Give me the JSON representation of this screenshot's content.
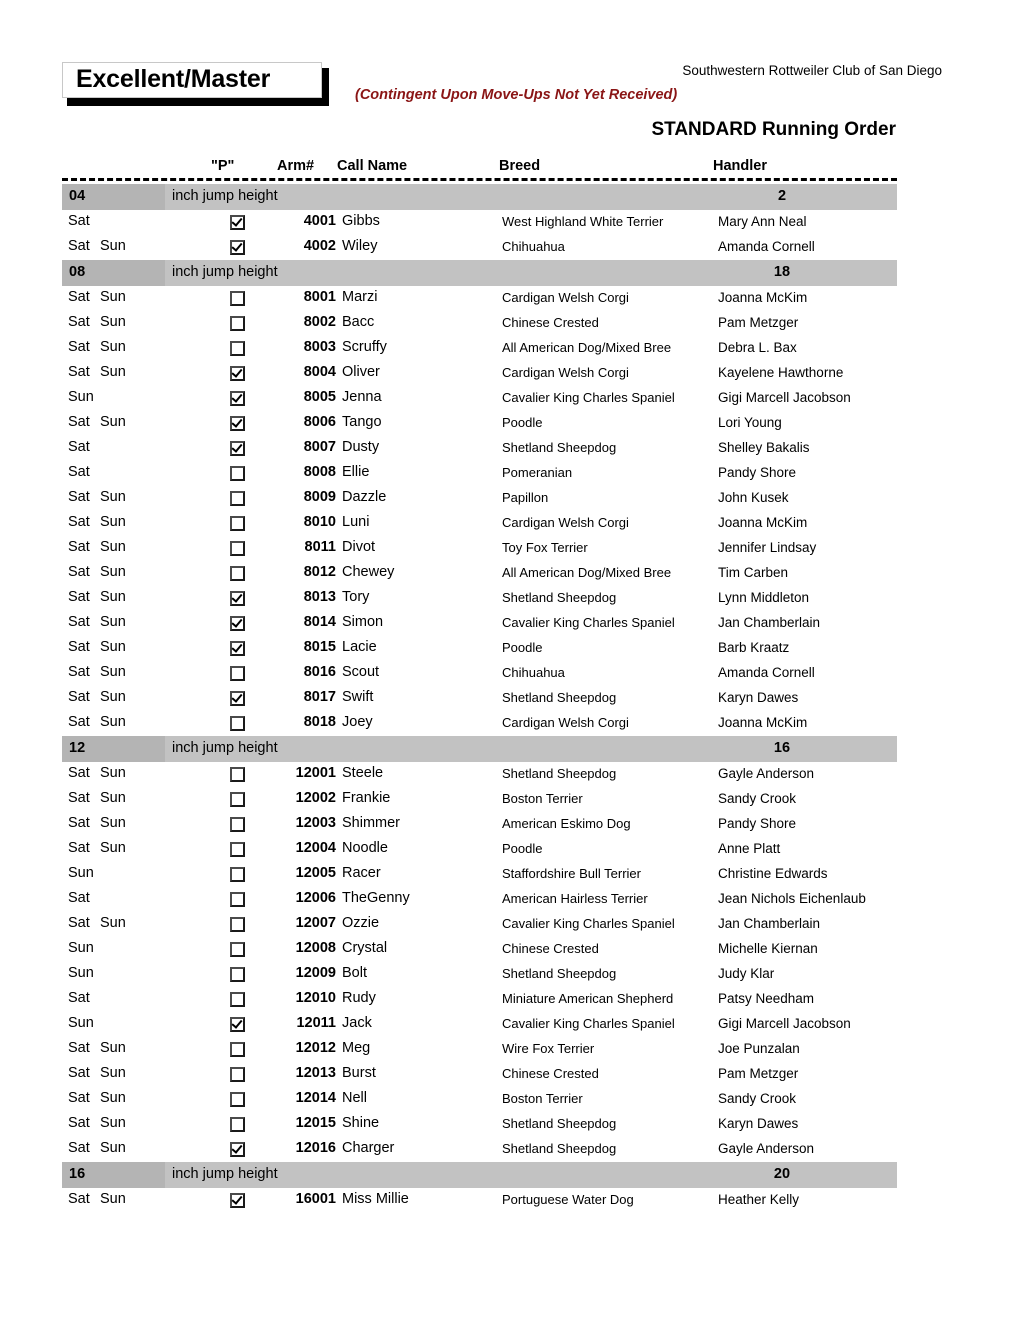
{
  "header": {
    "title": "Excellent/Master",
    "club_name": "Southwestern Rottweiler Club of San Diego",
    "contingent_note": "(Contingent Upon Move-Ups Not Yet Received)",
    "running_order": "STANDARD Running Order",
    "accent_color": "#8a1515"
  },
  "columns": {
    "days": "",
    "p": "\"P\"",
    "arm": "Arm#",
    "call_name": "Call Name",
    "breed": "Breed",
    "handler": "Handler"
  },
  "band_label": "inch jump height",
  "groups": [
    {
      "height": "04",
      "label": "inch jump height",
      "count": "2",
      "rows": [
        {
          "days_sat": "Sat",
          "days_sun": "",
          "checked": true,
          "arm": "4001",
          "call_name": "Gibbs",
          "breed": "West Highland White Terrier",
          "handler": "Mary Ann Neal"
        },
        {
          "days_sat": "Sat",
          "days_sun": "Sun",
          "checked": true,
          "arm": "4002",
          "call_name": "Wiley",
          "breed": "Chihuahua",
          "handler": "Amanda Cornell"
        }
      ]
    },
    {
      "height": "08",
      "label": "inch jump height",
      "count": "18",
      "rows": [
        {
          "days_sat": "Sat",
          "days_sun": "Sun",
          "checked": false,
          "arm": "8001",
          "call_name": "Marzi",
          "breed": "Cardigan Welsh Corgi",
          "handler": "Joanna McKim"
        },
        {
          "days_sat": "Sat",
          "days_sun": "Sun",
          "checked": false,
          "arm": "8002",
          "call_name": "Bacc",
          "breed": "Chinese Crested",
          "handler": "Pam Metzger"
        },
        {
          "days_sat": "Sat",
          "days_sun": "Sun",
          "checked": false,
          "arm": "8003",
          "call_name": "Scruffy",
          "breed": "All American Dog/Mixed Bree",
          "handler": "Debra L. Bax"
        },
        {
          "days_sat": "Sat",
          "days_sun": "Sun",
          "checked": true,
          "arm": "8004",
          "call_name": "Oliver",
          "breed": "Cardigan Welsh Corgi",
          "handler": "Kayelene Hawthorne"
        },
        {
          "days_sat": "Sun",
          "days_sun": "",
          "checked": true,
          "arm": "8005",
          "call_name": "Jenna",
          "breed": "Cavalier King Charles Spaniel",
          "handler": "Gigi Marcell Jacobson"
        },
        {
          "days_sat": "Sat",
          "days_sun": "Sun",
          "checked": true,
          "arm": "8006",
          "call_name": "Tango",
          "breed": "Poodle",
          "handler": "Lori Young"
        },
        {
          "days_sat": "Sat",
          "days_sun": "",
          "checked": true,
          "arm": "8007",
          "call_name": "Dusty",
          "breed": "Shetland Sheepdog",
          "handler": "Shelley Bakalis"
        },
        {
          "days_sat": "Sat",
          "days_sun": "",
          "checked": false,
          "arm": "8008",
          "call_name": "Ellie",
          "breed": "Pomeranian",
          "handler": "Pandy Shore"
        },
        {
          "days_sat": "Sat",
          "days_sun": "Sun",
          "checked": false,
          "arm": "8009",
          "call_name": "Dazzle",
          "breed": "Papillon",
          "handler": "John Kusek"
        },
        {
          "days_sat": "Sat",
          "days_sun": "Sun",
          "checked": false,
          "arm": "8010",
          "call_name": "Luni",
          "breed": "Cardigan Welsh Corgi",
          "handler": "Joanna McKim"
        },
        {
          "days_sat": "Sat",
          "days_sun": "Sun",
          "checked": false,
          "arm": "8011",
          "call_name": "Divot",
          "breed": "Toy Fox Terrier",
          "handler": "Jennifer Lindsay"
        },
        {
          "days_sat": "Sat",
          "days_sun": "Sun",
          "checked": false,
          "arm": "8012",
          "call_name": "Chewey",
          "breed": "All American Dog/Mixed Bree",
          "handler": "Tim Carben"
        },
        {
          "days_sat": "Sat",
          "days_sun": "Sun",
          "checked": true,
          "arm": "8013",
          "call_name": "Tory",
          "breed": "Shetland Sheepdog",
          "handler": "Lynn Middleton"
        },
        {
          "days_sat": "Sat",
          "days_sun": "Sun",
          "checked": true,
          "arm": "8014",
          "call_name": "Simon",
          "breed": "Cavalier King Charles Spaniel",
          "handler": "Jan Chamberlain"
        },
        {
          "days_sat": "Sat",
          "days_sun": "Sun",
          "checked": true,
          "arm": "8015",
          "call_name": "Lacie",
          "breed": "Poodle",
          "handler": "Barb Kraatz"
        },
        {
          "days_sat": "Sat",
          "days_sun": "Sun",
          "checked": false,
          "arm": "8016",
          "call_name": "Scout",
          "breed": "Chihuahua",
          "handler": "Amanda Cornell"
        },
        {
          "days_sat": "Sat",
          "days_sun": "Sun",
          "checked": true,
          "arm": "8017",
          "call_name": "Swift",
          "breed": "Shetland Sheepdog",
          "handler": "Karyn Dawes"
        },
        {
          "days_sat": "Sat",
          "days_sun": "Sun",
          "checked": false,
          "arm": "8018",
          "call_name": "Joey",
          "breed": "Cardigan Welsh Corgi",
          "handler": "Joanna McKim"
        }
      ]
    },
    {
      "height": "12",
      "label": "inch jump height",
      "count": "16",
      "rows": [
        {
          "days_sat": "Sat",
          "days_sun": "Sun",
          "checked": false,
          "arm": "12001",
          "call_name": "Steele",
          "breed": "Shetland Sheepdog",
          "handler": "Gayle Anderson"
        },
        {
          "days_sat": "Sat",
          "days_sun": "Sun",
          "checked": false,
          "arm": "12002",
          "call_name": "Frankie",
          "breed": "Boston Terrier",
          "handler": "Sandy Crook"
        },
        {
          "days_sat": "Sat",
          "days_sun": "Sun",
          "checked": false,
          "arm": "12003",
          "call_name": "Shimmer",
          "breed": "American Eskimo Dog",
          "handler": "Pandy Shore"
        },
        {
          "days_sat": "Sat",
          "days_sun": "Sun",
          "checked": false,
          "arm": "12004",
          "call_name": "Noodle",
          "breed": "Poodle",
          "handler": "Anne Platt"
        },
        {
          "days_sat": "Sun",
          "days_sun": "",
          "checked": false,
          "arm": "12005",
          "call_name": "Racer",
          "breed": "Staffordshire Bull Terrier",
          "handler": "Christine Edwards"
        },
        {
          "days_sat": "Sat",
          "days_sun": "",
          "checked": false,
          "arm": "12006",
          "call_name": "TheGenny",
          "breed": "American Hairless Terrier",
          "handler": "Jean Nichols Eichenlaub"
        },
        {
          "days_sat": "Sat",
          "days_sun": "Sun",
          "checked": false,
          "arm": "12007",
          "call_name": "Ozzie",
          "breed": "Cavalier King Charles Spaniel",
          "handler": "Jan Chamberlain"
        },
        {
          "days_sat": "Sun",
          "days_sun": "",
          "checked": false,
          "arm": "12008",
          "call_name": "Crystal",
          "breed": "Chinese Crested",
          "handler": "Michelle Kiernan"
        },
        {
          "days_sat": "Sun",
          "days_sun": "",
          "checked": false,
          "arm": "12009",
          "call_name": "Bolt",
          "breed": "Shetland Sheepdog",
          "handler": "Judy Klar"
        },
        {
          "days_sat": "Sat",
          "days_sun": "",
          "checked": false,
          "arm": "12010",
          "call_name": "Rudy",
          "breed": "Miniature American Shepherd",
          "handler": "Patsy Needham"
        },
        {
          "days_sat": "Sun",
          "days_sun": "",
          "checked": true,
          "arm": "12011",
          "call_name": "Jack",
          "breed": "Cavalier King Charles Spaniel",
          "handler": "Gigi Marcell Jacobson"
        },
        {
          "days_sat": "Sat",
          "days_sun": "Sun",
          "checked": false,
          "arm": "12012",
          "call_name": "Meg",
          "breed": "Wire Fox Terrier",
          "handler": "Joe Punzalan"
        },
        {
          "days_sat": "Sat",
          "days_sun": "Sun",
          "checked": false,
          "arm": "12013",
          "call_name": "Burst",
          "breed": "Chinese Crested",
          "handler": "Pam Metzger"
        },
        {
          "days_sat": "Sat",
          "days_sun": "Sun",
          "checked": false,
          "arm": "12014",
          "call_name": "Nell",
          "breed": "Boston Terrier",
          "handler": "Sandy Crook"
        },
        {
          "days_sat": "Sat",
          "days_sun": "Sun",
          "checked": false,
          "arm": "12015",
          "call_name": "Shine",
          "breed": "Shetland Sheepdog",
          "handler": "Karyn Dawes"
        },
        {
          "days_sat": "Sat",
          "days_sun": "Sun",
          "checked": true,
          "arm": "12016",
          "call_name": "Charger",
          "breed": "Shetland Sheepdog",
          "handler": "Gayle Anderson"
        }
      ]
    },
    {
      "height": "16",
      "label": "inch jump height",
      "count": "20",
      "rows": [
        {
          "days_sat": "Sat",
          "days_sun": "Sun",
          "checked": true,
          "arm": "16001",
          "call_name": "Miss Millie",
          "breed": "Portuguese Water Dog",
          "handler": "Heather Kelly"
        }
      ]
    }
  ]
}
